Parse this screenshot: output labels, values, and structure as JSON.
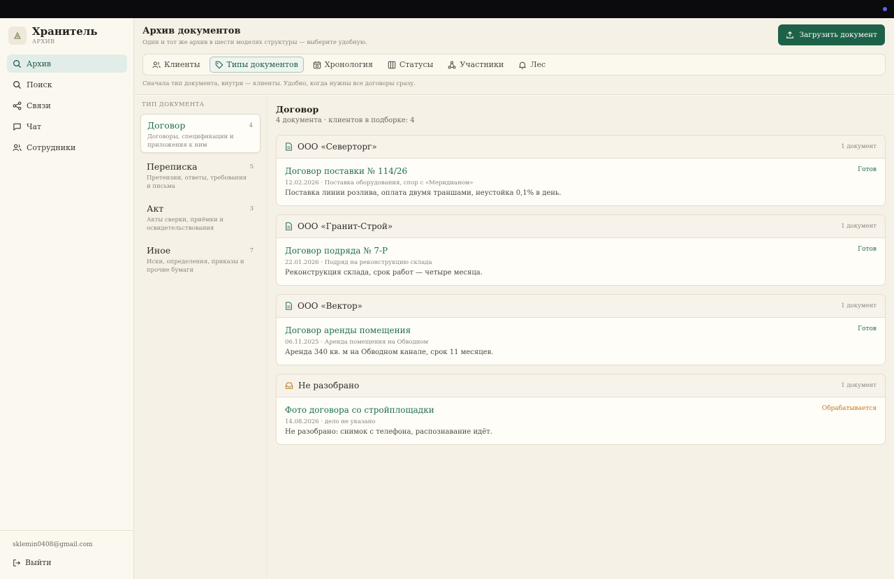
{
  "brand": {
    "title": "Хранитель",
    "subtitle": "АРХИВ"
  },
  "nav": [
    {
      "label": "Архив",
      "icon": "search-icon",
      "active": true
    },
    {
      "label": "Поиск",
      "icon": "search-icon"
    },
    {
      "label": "Связи",
      "icon": "share-icon"
    },
    {
      "label": "Чат",
      "icon": "chat-icon"
    },
    {
      "label": "Сотрудники",
      "icon": "users-icon"
    }
  ],
  "user": {
    "email": "sklemin0408@gmail.com",
    "logout_label": "Выйти"
  },
  "header": {
    "title": "Архив документов",
    "subtitle": "Один и тот же архив в шести моделях структуры — выберите удобную.",
    "upload_label": "Загрузить документ",
    "hint": "Сначала тип документа, внутри — клиенты. Удобно, когда нужны все договоры сразу."
  },
  "tabs": [
    {
      "label": "Клиенты",
      "icon": "users-icon"
    },
    {
      "label": "Типы документов",
      "icon": "tag-icon",
      "active": true
    },
    {
      "label": "Хронология",
      "icon": "calendar-icon"
    },
    {
      "label": "Статусы",
      "icon": "columns-icon"
    },
    {
      "label": "Участники",
      "icon": "network-icon"
    },
    {
      "label": "Лес",
      "icon": "bell-icon"
    }
  ],
  "types": {
    "label": "Тип документа",
    "items": [
      {
        "name": "Договор",
        "count": "4",
        "desc": "Договоры, спецификации и приложения к ним",
        "active": true
      },
      {
        "name": "Переписка",
        "count": "5",
        "desc": "Претензии, ответы, требования и письма"
      },
      {
        "name": "Акт",
        "count": "3",
        "desc": "Акты сверки, приёмки и освидетельствования"
      },
      {
        "name": "Иное",
        "count": "7",
        "desc": "Иски, определения, приказы и прочие бумаги"
      }
    ]
  },
  "section": {
    "title": "Договор",
    "subtitle": "4 документа · клиентов в подборке: 4"
  },
  "groups": [
    {
      "name": "ООО «Северторг»",
      "icon": "document-icon",
      "count": "1 документ",
      "doc": {
        "title": "Договор поставки № 114/26",
        "meta": "12.02.2026 · Поставка оборудования, спор с «Меридианом»",
        "desc": "Поставка линии розлива, оплата двумя траншами, неустойка 0,1% в день.",
        "status": "Готов"
      }
    },
    {
      "name": "ООО «Гранит-Строй»",
      "icon": "document-icon",
      "count": "1 документ",
      "doc": {
        "title": "Договор подряда № 7-Р",
        "meta": "22.01.2026 · Подряд на реконструкцию склада",
        "desc": "Реконструкция склада, срок работ — четыре месяца.",
        "status": "Готов"
      }
    },
    {
      "name": "ООО «Вектор»",
      "icon": "document-icon",
      "count": "1 документ",
      "doc": {
        "title": "Договор аренды помещения",
        "meta": "06.11.2025 · Аренда помещения на Обводном",
        "desc": "Аренда 340 кв. м на Обводном канале, срок 11 месяцев.",
        "status": "Готов"
      }
    },
    {
      "name": "Не разобрано",
      "icon": "inbox-icon",
      "count": "1 документ",
      "doc": {
        "title": "Фото договора со стройплощадки",
        "meta": "14.08.2026 · дело не указано",
        "desc": "Не разобрано: снимок с телефона, распознавание идёт.",
        "status": "Обрабатывается"
      }
    }
  ],
  "colors": {
    "accent": "#1d6148",
    "active_bg": "#e1ede6",
    "processing": "#c07a20"
  }
}
